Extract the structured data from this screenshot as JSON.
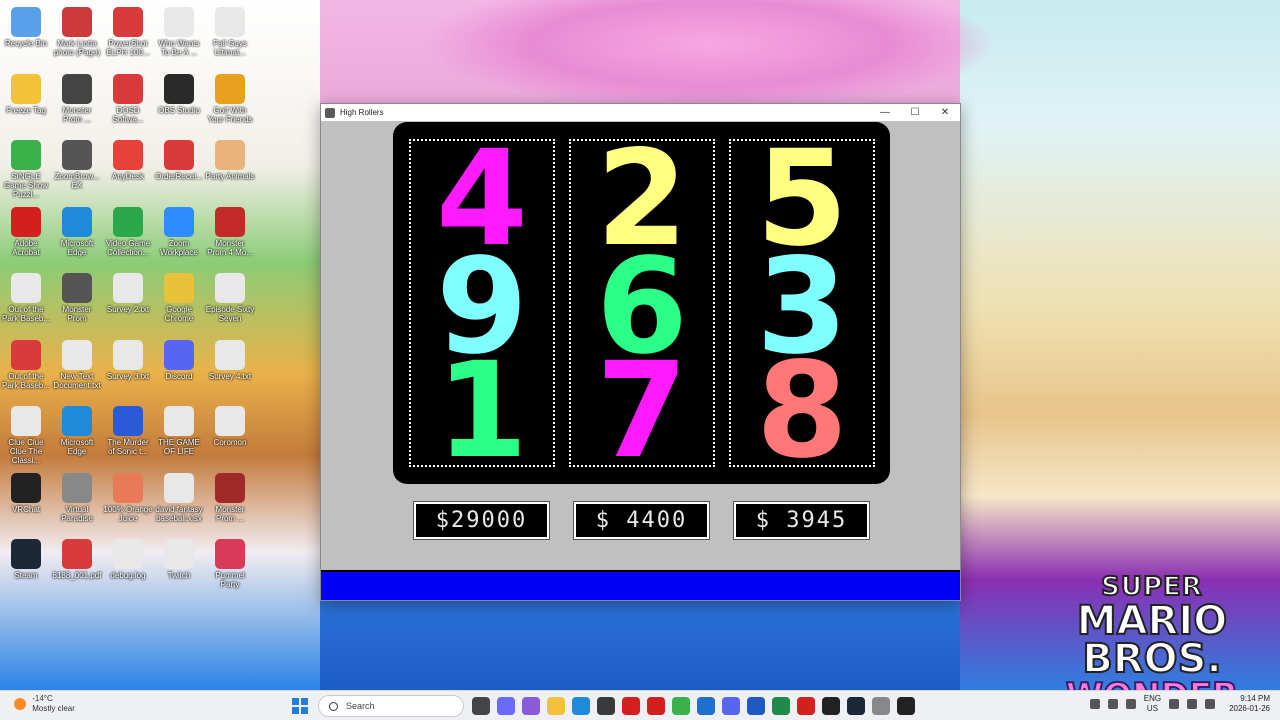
{
  "desktop": {
    "icons": [
      {
        "label": "Recycle Bin",
        "color": "#5aa0e8"
      },
      {
        "label": "Mark Liotta photo (Page)",
        "color": "#cc3a3a"
      },
      {
        "label": "PowerShot ELPH 100...",
        "color": "#d93a3a"
      },
      {
        "label": "Who Wants To Be A ...",
        "color": "#e8e8e8"
      },
      {
        "label": "Fall Guys Ultimat...",
        "color": "#e8e8e8"
      },
      {
        "label": "Freeze Tag",
        "color": "#f2c23a"
      },
      {
        "label": "Monster Prom ...",
        "color": "#444444"
      },
      {
        "label": "DOSD Softwa...",
        "color": "#d93a3a"
      },
      {
        "label": "OBS Studio",
        "color": "#2a2a2a"
      },
      {
        "label": "Golf With Your Friends",
        "color": "#e8a020"
      },
      {
        "label": "SINGLE Game Show Puzzl...",
        "color": "#3ab14a"
      },
      {
        "label": "ZoomBrow... EX",
        "color": "#555555"
      },
      {
        "label": "AnyDesk",
        "color": "#e8413a"
      },
      {
        "label": "OrderRecei...",
        "color": "#d93a3a"
      },
      {
        "label": "Party Animals",
        "color": "#e8b47a"
      },
      {
        "label": "Adobe Acrobat",
        "color": "#d41f1f"
      },
      {
        "label": "Microsoft Edge",
        "color": "#1f8ad9"
      },
      {
        "label": "Video Game Collection...",
        "color": "#2aa84a"
      },
      {
        "label": "Zoom Workplace",
        "color": "#2d8cff"
      },
      {
        "label": "Monster Prom 4 Mo...",
        "color": "#c22a2a"
      },
      {
        "label": "Out of the Park Baseb...",
        "color": "#e8e8e8"
      },
      {
        "label": "Monster Prom",
        "color": "#555555"
      },
      {
        "label": "Survey 2.txt",
        "color": "#e8e8e8"
      },
      {
        "label": "Google Chrome",
        "color": "#e8c33a"
      },
      {
        "label": "Episode Sixty Seven",
        "color": "#e8e8e8"
      },
      {
        "label": "Out of the Park Baseb...",
        "color": "#d93a3a"
      },
      {
        "label": "New Text Document.txt",
        "color": "#e8e8e8"
      },
      {
        "label": "Survey 3.txt",
        "color": "#e8e8e8"
      },
      {
        "label": "Discord",
        "color": "#5865f2"
      },
      {
        "label": "Survey 4.txt",
        "color": "#e8e8e8"
      },
      {
        "label": "Clue Clue Clue The Classi...",
        "color": "#e8e8e8"
      },
      {
        "label": "Microsoft Edge",
        "color": "#1f8ad9"
      },
      {
        "label": "The Murder of Sonic t...",
        "color": "#2a5ad9"
      },
      {
        "label": "THE GAME OF LIFE",
        "color": "#e8e8e8"
      },
      {
        "label": "Coromon",
        "color": "#e8e8e8"
      },
      {
        "label": "VRChat",
        "color": "#222222"
      },
      {
        "label": "Virtual Paradise",
        "color": "#888888"
      },
      {
        "label": "100% Orange Juice",
        "color": "#e87a5a"
      },
      {
        "label": "david fantasy baseball.xlsx",
        "color": "#e8e8e8"
      },
      {
        "label": "Monster Prom ...",
        "color": "#a02a2a"
      },
      {
        "label": "Steam",
        "color": "#1b2838"
      },
      {
        "label": "8188_001.pdf",
        "color": "#d93a3a"
      },
      {
        "label": "debug.log",
        "color": "#e8e8e8"
      },
      {
        "label": "Twitch",
        "color": "#e8e8e8"
      },
      {
        "label": "Pummel Party",
        "color": "#d93a5a"
      }
    ]
  },
  "wallpaper": {
    "logo_line1": "SUPER",
    "logo_line2": "MARIO BROS.",
    "logo_line3": "WONDER"
  },
  "window": {
    "title": "High Rollers",
    "controls": {
      "minimize": "—",
      "maximize": "☐",
      "close": "✕"
    },
    "reels": [
      {
        "digits": [
          {
            "value": "4",
            "color": "#ff1aff"
          },
          {
            "value": "9",
            "color": "#7fffff"
          },
          {
            "value": "1",
            "color": "#2bff88"
          }
        ]
      },
      {
        "digits": [
          {
            "value": "2",
            "color": "#ffff80"
          },
          {
            "value": "6",
            "color": "#2bff88"
          },
          {
            "value": "7",
            "color": "#ff1aff"
          }
        ]
      },
      {
        "digits": [
          {
            "value": "5",
            "color": "#ffff80"
          },
          {
            "value": "3",
            "color": "#7fffff"
          },
          {
            "value": "8",
            "color": "#ff7777"
          }
        ]
      }
    ],
    "counters": [
      "$29000",
      "$ 4400",
      "$ 3945"
    ]
  },
  "taskbar": {
    "weather_temp": "-14°C",
    "weather_desc": "Mostly clear",
    "search_placeholder": "Search",
    "app_colors": [
      "#444444",
      "#6a6aff",
      "#8a5ad9",
      "#f2c23a",
      "#1f8ad9",
      "#3a3a3a",
      "#d41f1f",
      "#d41f1f",
      "#3ab14a",
      "#1f6fd0",
      "#5865f2",
      "#1f5ac0",
      "#1f8a4a",
      "#d41f1f",
      "#222222",
      "#1b2838",
      "#888888",
      "#222222"
    ],
    "lang_line1": "ENG",
    "lang_line2": "US",
    "time": "9:14 PM",
    "date": "2026-01-26"
  }
}
